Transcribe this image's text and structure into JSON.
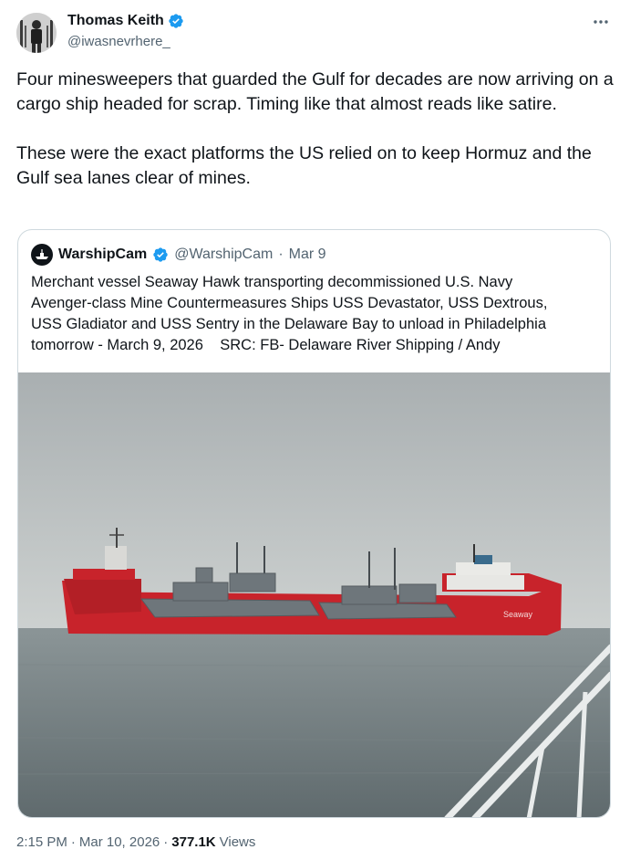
{
  "author": {
    "name": "Thomas Keith",
    "handle": "@iwasnevrhere_",
    "verified": true,
    "avatar_icon": "avatar-photo"
  },
  "tweet": {
    "paragraphs": [
      "Four minesweepers that guarded the Gulf for decades are now arriving on a cargo ship headed for scrap. Timing like that almost reads like satire.",
      "These were the exact platforms the US relied on to keep Hormuz and the Gulf sea lanes clear of mines."
    ]
  },
  "quote": {
    "name": "WarshipCam",
    "handle": "@WarshipCam",
    "separator": "·",
    "date": "Mar 9",
    "verified": true,
    "text": [
      "Merchant vessel Seaway Hawk transporting decommissioned U.S. Navy",
      "Avenger-class Mine Countermeasures Ships USS Devastator, USS Dextrous,",
      "USS Gladiator and USS Sentry in the Delaware Bay to unload in Philadelphia",
      "tomorrow - March 9, 2026    SRC: FB- Delaware River Shipping / Andy"
    ],
    "image_alt": "Red heavy-lift cargo ship carrying four grey minesweepers on a grey sea",
    "hull_lettering": "Seaway"
  },
  "meta": {
    "time": "2:15 PM",
    "dot1": "·",
    "date": "Mar 10, 2026",
    "dot2": "·",
    "views": "377.1K",
    "views_label": "Views"
  },
  "colors": {
    "text": "#0f1419",
    "secondary": "#536471",
    "verified": "#1d9bf0",
    "border": "#cfd9de",
    "hull": "#c8232b"
  }
}
